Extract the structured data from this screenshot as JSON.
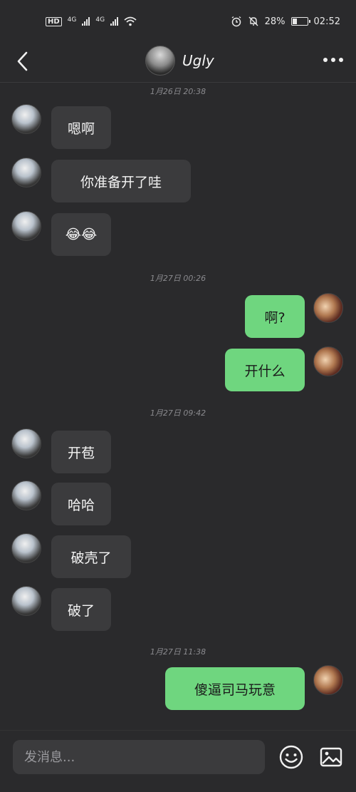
{
  "status_bar": {
    "hd": "HD",
    "network_1": "4G",
    "network_2": "4G",
    "battery": "28%",
    "battery_level": 0.28,
    "time": "02:52"
  },
  "header": {
    "title": "Ugly"
  },
  "messages": [
    {
      "type": "timestamp",
      "text": "1月26日 20:38"
    },
    {
      "type": "message",
      "sender": "them",
      "text": "嗯啊"
    },
    {
      "type": "message",
      "sender": "them",
      "text": "你准备开了哇"
    },
    {
      "type": "message",
      "sender": "them",
      "text": "😂😂"
    },
    {
      "type": "timestamp",
      "text": "1月27日 00:26"
    },
    {
      "type": "message",
      "sender": "me",
      "text": "啊?"
    },
    {
      "type": "message",
      "sender": "me",
      "text": "开什么"
    },
    {
      "type": "timestamp",
      "text": "1月27日 09:42"
    },
    {
      "type": "message",
      "sender": "them",
      "text": "开苞"
    },
    {
      "type": "message",
      "sender": "them",
      "text": "哈哈"
    },
    {
      "type": "message",
      "sender": "them",
      "text": "破壳了"
    },
    {
      "type": "message",
      "sender": "them",
      "text": "破了"
    },
    {
      "type": "timestamp",
      "text": "1月27日 11:38"
    },
    {
      "type": "message",
      "sender": "me",
      "text": "傻逼司马玩意"
    }
  ],
  "input": {
    "placeholder": "发消息..."
  },
  "colors": {
    "background": "#2a2a2c",
    "bubble_them": "#3b3b3d",
    "bubble_me": "#6fd67f"
  },
  "icons": {
    "back": "chevron-left-icon",
    "more": "more-dots-icon",
    "emoji": "smiley-icon",
    "image": "image-icon",
    "alarm": "alarm-icon",
    "mute": "bell-off-icon",
    "wifi": "wifi-icon"
  }
}
